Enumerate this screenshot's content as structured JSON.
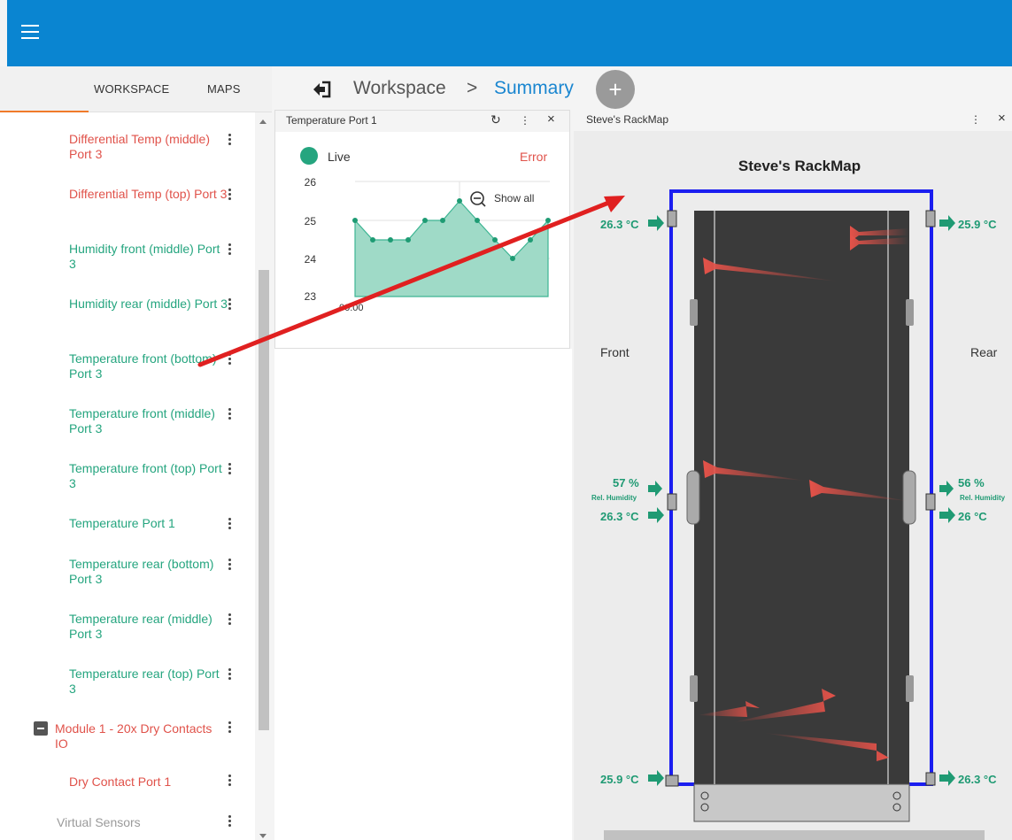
{
  "app": {
    "menu_icon": "hamburger-menu-icon",
    "accent": "#0a85d1"
  },
  "left_tabs": {
    "workspace": "WORKSPACE",
    "maps": "MAPS"
  },
  "tree": [
    {
      "label": "Differential Temp (middle) Port 3",
      "color": "red"
    },
    {
      "label": "Differential Temp (top) Port 3",
      "color": "red"
    },
    {
      "label": "Humidity front (middle) Port 3",
      "color": "green"
    },
    {
      "label": "Humidity rear (middle) Port 3",
      "color": "green"
    },
    {
      "label": "Temperature front (bottom) Port 3",
      "color": "green"
    },
    {
      "label": "Temperature front (middle) Port 3",
      "color": "green"
    },
    {
      "label": "Temperature front (top) Port 3",
      "color": "green"
    },
    {
      "label": "Temperature Port 1",
      "color": "green"
    },
    {
      "label": "Temperature rear (bottom) Port 3",
      "color": "green"
    },
    {
      "label": "Temperature rear (middle) Port 3",
      "color": "green"
    },
    {
      "label": "Temperature rear (top) Port 3",
      "color": "green"
    },
    {
      "label": "Module 1 - 20x Dry Contacts IO",
      "color": "red"
    },
    {
      "label": "Dry Contact Port 1",
      "color": "red"
    },
    {
      "label": "Virtual Sensors",
      "color": "gray"
    }
  ],
  "breadcrumb": {
    "root": "Workspace",
    "separator": ">",
    "current": "Summary"
  },
  "add_button": "+",
  "temp_widget": {
    "title": "Temperature Port 1",
    "status": "Live",
    "error": "Error",
    "show_all": "Show all",
    "refresh_icon": "refresh-icon",
    "x_tick": "00:00",
    "chart_data": {
      "type": "area",
      "yticks": [
        "26",
        "25",
        "24",
        "23"
      ],
      "ylim": [
        23,
        26
      ],
      "values": [
        25.0,
        24.5,
        24.5,
        24.5,
        25.0,
        25.0,
        25.5,
        25.0,
        24.5,
        24.0,
        24.5,
        25.0
      ]
    }
  },
  "rackmap": {
    "widget_title": "Steve's RackMap",
    "title": "Steve's RackMap",
    "front": "Front",
    "rear": "Rear",
    "front_top": "26.3 °C",
    "rear_top": "25.9 °C",
    "front_hum": "57 %",
    "rear_hum": "56 %",
    "hum_label": "Rel. Humidity",
    "front_mid": "26.3 °C",
    "rear_mid": "26 °C",
    "front_bottom": "25.9 °C",
    "rear_bottom": "26.3 °C"
  }
}
